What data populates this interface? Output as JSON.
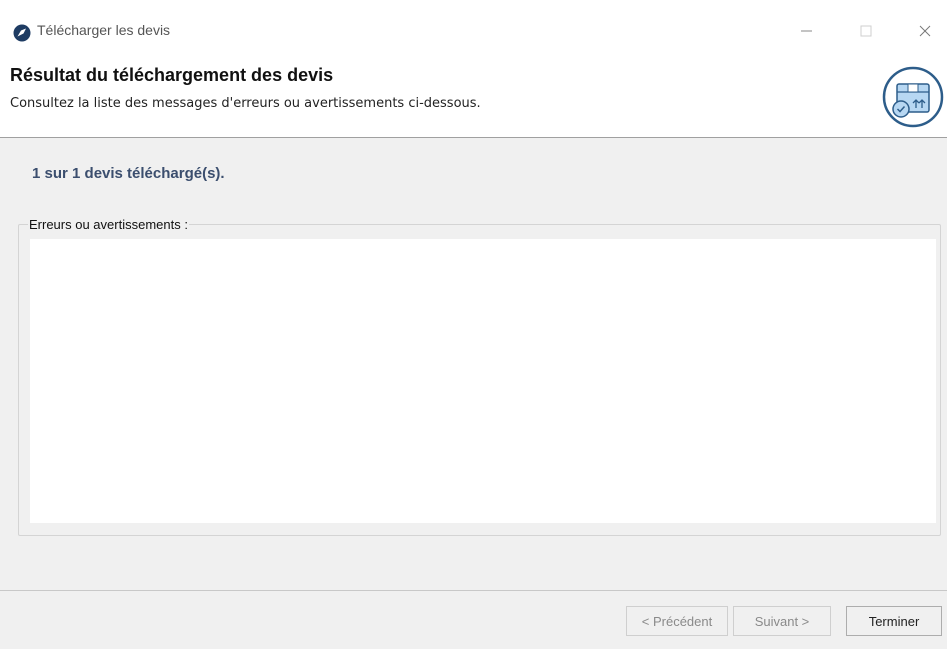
{
  "window": {
    "title": "Télécharger les devis",
    "app_icon": "app-logo-icon",
    "controls": [
      "minimize-icon",
      "maximize-icon",
      "close-icon"
    ]
  },
  "header": {
    "title": "Résultat du téléchargement des devis",
    "subtitle": "Consultez la liste des messages d'erreurs ou avertissements ci-dessous.",
    "icon": "box-upload-icon"
  },
  "main": {
    "status": "1 sur 1 devis téléchargé(s).",
    "messages_label": "Erreurs ou avertissements :",
    "messages_value": ""
  },
  "footer": {
    "prev_label": "< Précédent",
    "next_label": "Suivant >",
    "finish_label": "Terminer"
  },
  "colors": {
    "status_text": "#3b4e6e",
    "icon_blue": "#2d5d8a",
    "icon_light": "#b7d7f2"
  }
}
